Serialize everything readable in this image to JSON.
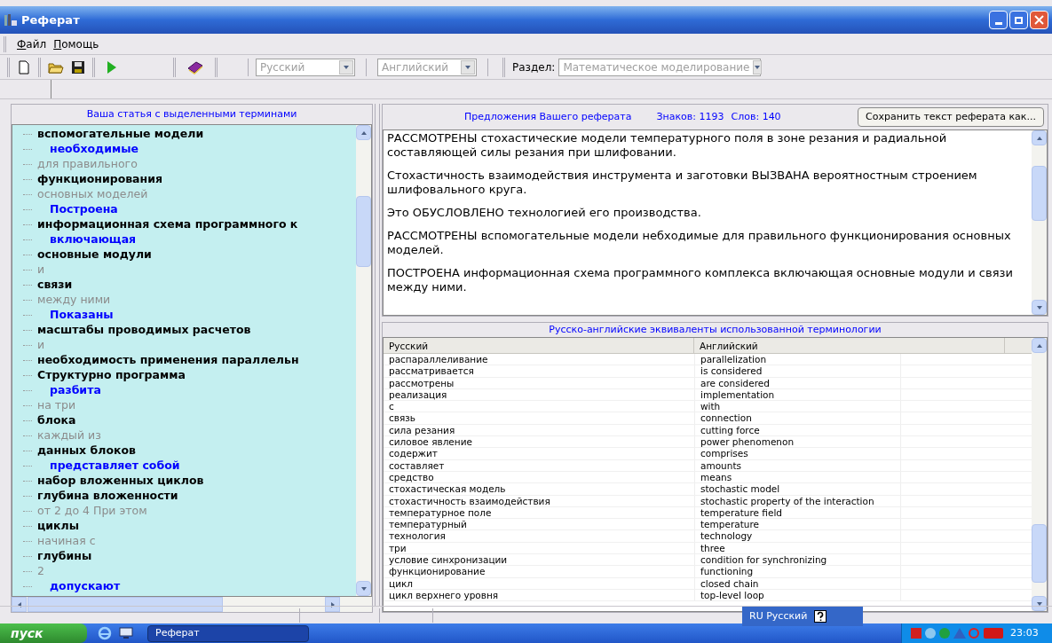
{
  "window": {
    "title": "Реферат"
  },
  "menu": [
    "Файл",
    "Помощь"
  ],
  "toolbar": {
    "language_from": {
      "value": "Русский",
      "disabled": true
    },
    "language_to": {
      "value": "Английский",
      "disabled": true
    },
    "section_label": "Раздел:",
    "section": {
      "value": "Математическое моделирование",
      "disabled": true
    }
  },
  "article_panel": {
    "title": "Ваша статья с выделенными терминами",
    "items": [
      {
        "text": "вспомогательные модели",
        "kind": "term"
      },
      {
        "text": "необходимые",
        "kind": "verb"
      },
      {
        "text": "для правильного",
        "kind": "filler"
      },
      {
        "text": "функционирования",
        "kind": "term"
      },
      {
        "text": "основных моделей",
        "kind": "filler"
      },
      {
        "text": "Построена",
        "kind": "verb"
      },
      {
        "text": "информационная схема программного к",
        "kind": "term"
      },
      {
        "text": "включающая",
        "kind": "verb"
      },
      {
        "text": "основные модули",
        "kind": "term"
      },
      {
        "text": "и",
        "kind": "filler"
      },
      {
        "text": "связи",
        "kind": "term"
      },
      {
        "text": "между ними",
        "kind": "filler"
      },
      {
        "text": "Показаны",
        "kind": "verb"
      },
      {
        "text": "масштабы проводимых расчетов",
        "kind": "term"
      },
      {
        "text": "и",
        "kind": "filler"
      },
      {
        "text": "необходимость применения параллельн",
        "kind": "term"
      },
      {
        "text": "Структурно программа",
        "kind": "term"
      },
      {
        "text": "разбита",
        "kind": "verb"
      },
      {
        "text": "на три",
        "kind": "filler"
      },
      {
        "text": "блока",
        "kind": "term"
      },
      {
        "text": "каждый из",
        "kind": "filler"
      },
      {
        "text": "данных блоков",
        "kind": "term"
      },
      {
        "text": "представляет собой",
        "kind": "verb"
      },
      {
        "text": "набор вложенных циклов",
        "kind": "term"
      },
      {
        "text": "глубина вложенности",
        "kind": "term"
      },
      {
        "text": "от 2 до 4 При этом",
        "kind": "filler"
      },
      {
        "text": "циклы",
        "kind": "term"
      },
      {
        "text": "начиная с",
        "kind": "filler"
      },
      {
        "text": "глубины",
        "kind": "term"
      },
      {
        "text": "2",
        "kind": "filler"
      },
      {
        "text": "допускают",
        "kind": "verb"
      }
    ]
  },
  "summary_panel": {
    "title": "Предложения Вашего реферата",
    "chars": "Знаков: 1193",
    "words": "Слов: 140",
    "save_button": "Сохранить текст реферата как...",
    "paragraphs": [
      "РАССМОТРЕНЫ стохастические модели температурного поля в зоне резания и радиальной составляющей силы резания при шлифовании.",
      "Стохастичность взаимодействия инструмента и заготовки ВЫЗВАНА вероятностным строением шлифовального круга.",
      "Это ОБУСЛОВЛЕНО технологией его производства.",
      "РАССМОТРЕНЫ вспомогательные модели небходимые для правильного функционирования основных моделей.",
      "ПОСТРОЕНА информационная схема программного комплекса включающая основные модули и связи между ними."
    ]
  },
  "terms_panel": {
    "title": "Русско-английские эквиваленты использованной терминологии",
    "columns": [
      "Русский",
      "Английский"
    ],
    "rows": [
      {
        "ru": "распараллеливание",
        "en": "parallelization"
      },
      {
        "ru": "рассматривается",
        "en": "is considered"
      },
      {
        "ru": "рассмотрены",
        "en": "are considered"
      },
      {
        "ru": "реализация",
        "en": "implementation"
      },
      {
        "ru": "с",
        "en": "with"
      },
      {
        "ru": "связь",
        "en": "connection"
      },
      {
        "ru": "сила резания",
        "en": "cutting force"
      },
      {
        "ru": "силовое явление",
        "en": "power phenomenon"
      },
      {
        "ru": "содержит",
        "en": "comprises"
      },
      {
        "ru": "составляет",
        "en": "amounts"
      },
      {
        "ru": "средство",
        "en": "means"
      },
      {
        "ru": "стохастическая модель",
        "en": "stochastic model"
      },
      {
        "ru": "стохастичность взаимодействия",
        "en": "stochastic property of the interaction"
      },
      {
        "ru": "температурное поле",
        "en": "temperature field"
      },
      {
        "ru": "температурный",
        "en": "temperature"
      },
      {
        "ru": "технология",
        "en": "technology"
      },
      {
        "ru": "три",
        "en": "three"
      },
      {
        "ru": "условие синхронизации",
        "en": "condition for synchronizing"
      },
      {
        "ru": "функционирование",
        "en": "functioning"
      },
      {
        "ru": "цикл",
        "en": "closed chain"
      },
      {
        "ru": "цикл верхнего уровня",
        "en": "top-level loop"
      }
    ]
  },
  "language_bar": {
    "label": "RU Русский"
  },
  "taskbar": {
    "start": "пуск",
    "tasks": [
      {
        "label": "Реферат",
        "selected": true
      }
    ],
    "clock": "23:03"
  }
}
